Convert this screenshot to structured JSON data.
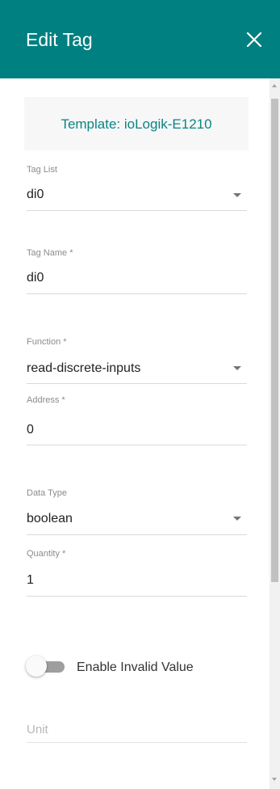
{
  "header": {
    "title": "Edit Tag",
    "close_icon": "close-icon"
  },
  "template": {
    "text": "Template: ioLogik-E1210"
  },
  "fields": {
    "tag_list": {
      "label": "Tag List",
      "value": "di0",
      "type": "dropdown"
    },
    "tag_name": {
      "label": "Tag Name *",
      "value": "di0",
      "type": "input"
    },
    "function": {
      "label": "Function *",
      "value": "read-discrete-inputs",
      "type": "dropdown"
    },
    "address": {
      "label": "Address *",
      "value": "0",
      "type": "input"
    },
    "data_type": {
      "label": "Data Type",
      "value": "boolean",
      "type": "dropdown"
    },
    "quantity": {
      "label": "Quantity *",
      "value": "1",
      "type": "input"
    }
  },
  "toggle": {
    "label": "Enable Invalid Value",
    "state": "off"
  },
  "unit": {
    "placeholder": "Unit",
    "value": ""
  },
  "colors": {
    "header_bg": "#008080",
    "accent_text": "#0a8585"
  }
}
